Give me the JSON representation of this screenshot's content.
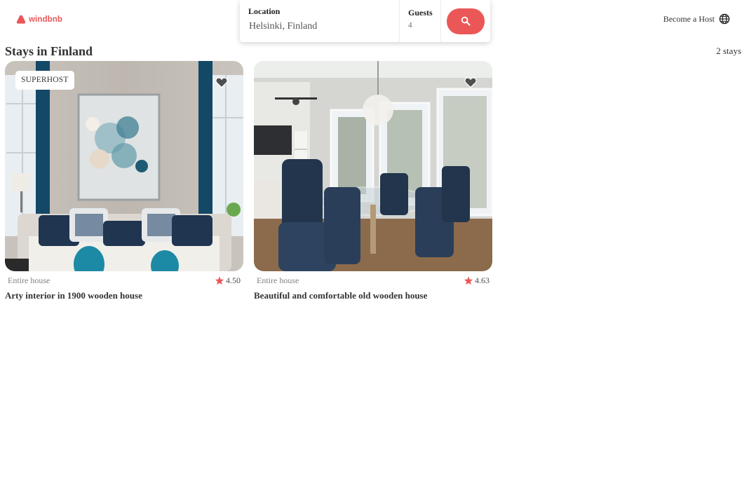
{
  "brand": {
    "name": "windbnb",
    "color": "#eb5757"
  },
  "search": {
    "location_label": "Location",
    "location_value": "Helsinki, Finland",
    "guests_label": "Guests",
    "guests_value": "4",
    "search_icon": "search-icon"
  },
  "header": {
    "host_label": "Become a Host",
    "host_icon": "globe-icon"
  },
  "section": {
    "title": "Stays in Finland",
    "count": "2 stays"
  },
  "stays": [
    {
      "superhost": true,
      "superhost_label": "SUPERHOST",
      "type": "Entire house",
      "rating": "4.50",
      "title": "Arty interior in 1900 wooden house",
      "favorite_icon": "heart-icon"
    },
    {
      "superhost": false,
      "type": "Entire house",
      "rating": "4.63",
      "title": "Beautiful and comfortable old wooden house",
      "favorite_icon": "heart-icon"
    }
  ],
  "colors": {
    "accent": "#eb5757",
    "star": "#eb5757",
    "text": "#333333",
    "muted": "#828282"
  }
}
